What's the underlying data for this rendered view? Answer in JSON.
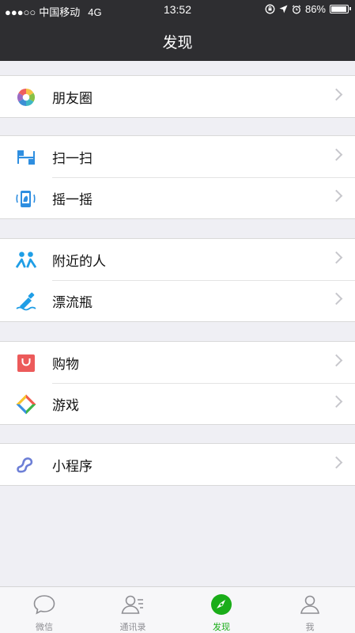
{
  "status_bar": {
    "signal": "●●●○○",
    "carrier": "中国移动",
    "network": "4G",
    "time": "13:52",
    "battery": "86%",
    "battery_level": 0.86
  },
  "nav": {
    "title": "发现"
  },
  "groups": [
    {
      "items": [
        {
          "label": "朋友圈",
          "icon": "moments-icon"
        }
      ]
    },
    {
      "items": [
        {
          "label": "扫一扫",
          "icon": "scan-icon"
        },
        {
          "label": "摇一摇",
          "icon": "shake-icon"
        }
      ]
    },
    {
      "items": [
        {
          "label": "附近的人",
          "icon": "people-nearby-icon"
        },
        {
          "label": "漂流瓶",
          "icon": "drift-bottle-icon"
        }
      ]
    },
    {
      "items": [
        {
          "label": "购物",
          "icon": "shopping-icon"
        },
        {
          "label": "游戏",
          "icon": "games-icon"
        }
      ]
    },
    {
      "items": [
        {
          "label": "小程序",
          "icon": "mini-program-icon"
        }
      ]
    }
  ],
  "tabbar": {
    "tabs": [
      {
        "label": "微信",
        "icon": "chat-bubble-icon"
      },
      {
        "label": "通讯录",
        "icon": "contacts-icon"
      },
      {
        "label": "发现",
        "icon": "discover-compass-icon",
        "active": true
      },
      {
        "label": "我",
        "icon": "me-icon"
      }
    ]
  },
  "colors": {
    "nav_bg": "#2e2e31",
    "accent": "#1aad19",
    "background": "#efeff4"
  }
}
